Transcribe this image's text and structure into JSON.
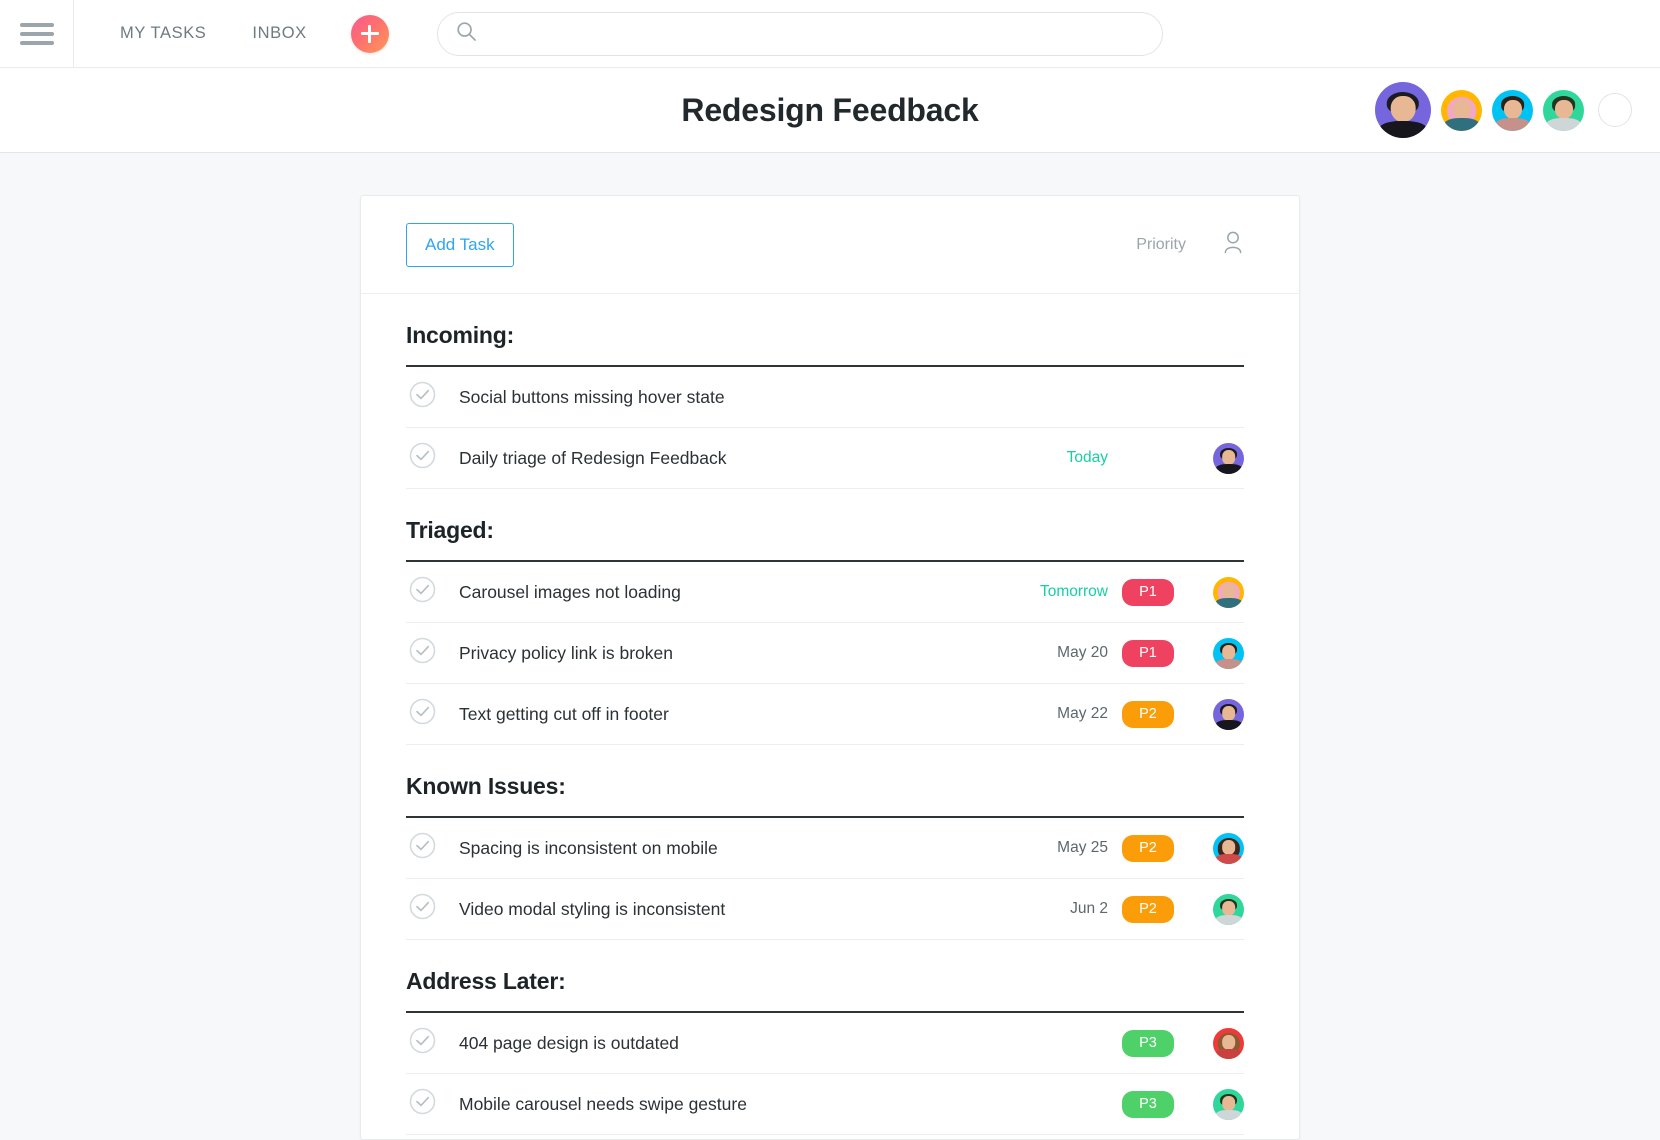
{
  "topnav": {
    "menu_icon": "hamburger-icon",
    "links": [
      {
        "label": "MY TASKS",
        "name": "nav-my-tasks"
      },
      {
        "label": "INBOX",
        "name": "nav-inbox"
      }
    ],
    "quick_add_label": "+",
    "search": {
      "placeholder": "",
      "value": "",
      "icon": "search-icon"
    }
  },
  "project": {
    "title": "Redesign Feedback",
    "members": [
      {
        "name": "member-avatar-1",
        "bg": "#7566de",
        "hair": "#1c1b22",
        "body": "#16161c",
        "style": "short"
      },
      {
        "name": "member-avatar-2",
        "bg": "#ffb703",
        "hair": "#f3a7c6",
        "body": "#2f6f7e",
        "style": "long"
      },
      {
        "name": "member-avatar-3",
        "bg": "#00c2f3",
        "hair": "#2b2118",
        "body": "#c4928b",
        "style": "short"
      },
      {
        "name": "member-avatar-4",
        "bg": "#2fd79b",
        "hair": "#24351f",
        "body": "#cfd6d8",
        "style": "short"
      }
    ],
    "add_member_label": "+"
  },
  "toolbar": {
    "add_task_label": "Add Task",
    "priority_label": "Priority",
    "assignee_icon": "person-icon"
  },
  "sections": [
    {
      "title": "Incoming:",
      "tasks": [
        {
          "name": "Social buttons missing hover state",
          "due": "",
          "due_soon": false,
          "priority": "",
          "priority_color": "",
          "avatar": null
        },
        {
          "name": "Daily triage of Redesign Feedback",
          "due": "Today",
          "due_soon": true,
          "priority": "",
          "priority_color": "",
          "avatar": {
            "bg": "#7566de",
            "hair": "#1c1b22",
            "body": "#16161c",
            "style": "short"
          }
        }
      ]
    },
    {
      "title": "Triaged:",
      "tasks": [
        {
          "name": "Carousel images not loading",
          "due": "Tomorrow",
          "due_soon": true,
          "priority": "P1",
          "priority_color": "#ee4260",
          "avatar": {
            "bg": "#ffb703",
            "hair": "#f3a7c6",
            "body": "#2f6f7e",
            "style": "long"
          }
        },
        {
          "name": "Privacy policy link is broken",
          "due": "May 20",
          "due_soon": false,
          "priority": "P1",
          "priority_color": "#ee4260",
          "avatar": {
            "bg": "#00c2f3",
            "hair": "#2b2118",
            "body": "#c4928b",
            "style": "short"
          }
        },
        {
          "name": "Text getting cut off in footer",
          "due": "May 22",
          "due_soon": false,
          "priority": "P2",
          "priority_color": "#fb9d08",
          "avatar": {
            "bg": "#7566de",
            "hair": "#1c1b22",
            "body": "#16161c",
            "style": "short"
          }
        }
      ]
    },
    {
      "title": "Known Issues:",
      "tasks": [
        {
          "name": "Spacing is inconsistent on mobile",
          "due": "May 25",
          "due_soon": false,
          "priority": "P2",
          "priority_color": "#fb9d08",
          "avatar": {
            "bg": "#00c2f3",
            "hair": "#40251c",
            "body": "#d14a4a",
            "style": "long"
          }
        },
        {
          "name": "Video modal styling is inconsistent",
          "due": "Jun 2",
          "due_soon": false,
          "priority": "P2",
          "priority_color": "#fb9d08",
          "avatar": {
            "bg": "#2fd79b",
            "hair": "#24351f",
            "body": "#cfd6d8",
            "style": "short"
          }
        }
      ]
    },
    {
      "title": "Address Later:",
      "tasks": [
        {
          "name": "404 page design is outdated",
          "due": "",
          "due_soon": false,
          "priority": "P3",
          "priority_color": "#4ed168",
          "avatar": {
            "bg": "#f03a3a",
            "hair": "#8a5a33",
            "body": "#c9413f",
            "style": "long"
          }
        },
        {
          "name": "Mobile carousel needs swipe gesture",
          "due": "",
          "due_soon": false,
          "priority": "P3",
          "priority_color": "#4ed168",
          "avatar": {
            "bg": "#2fd79b",
            "hair": "#24351f",
            "body": "#cfd6d8",
            "style": "short"
          }
        }
      ]
    }
  ],
  "colors": {
    "accent_blue": "#2fa5ef",
    "due_soon": "#17cfa4",
    "p1": "#ee4260",
    "p2": "#fb9d08",
    "p3": "#4ed168"
  }
}
